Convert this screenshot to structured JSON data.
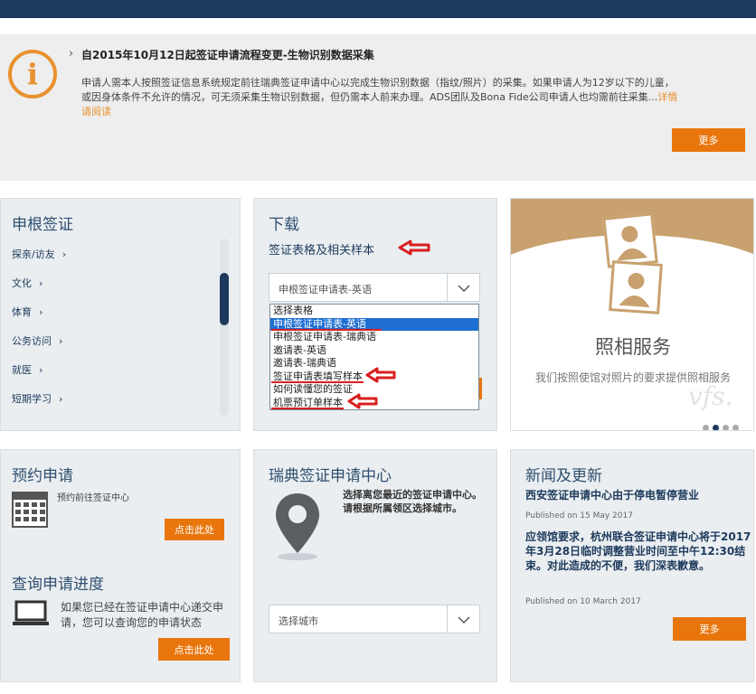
{
  "notice": {
    "chevron": "›",
    "icon": "i",
    "title": "自2015年10月12日起签证申请流程变更-生物识别数据采集",
    "body": "申请人需本人按照签证信息系统规定前往瑞典签证申请中心以完成生物识别数据（指纹/照片）的采集。如果申请人为12岁以下的儿童，或因身体条件不允许的情况，可无须采集生物识别数据，但仍需本人前来办理。ADS团队及Bona Fide公司申请人也均需前往采集...",
    "link": "详情请阅读",
    "more_label": "更多"
  },
  "schengen": {
    "title": "申根签证",
    "items": [
      "探亲/访友",
      "文化",
      "体育",
      "公务访问",
      "就医",
      "短期学习"
    ],
    "chevron": "›"
  },
  "download": {
    "title": "下载",
    "subtitle": "签证表格及相关样本",
    "select_value": "申根签证申请表-英语",
    "options": [
      "选择表格",
      "申根签证申请表-英语",
      "申根签证申请表-瑞典语",
      "邀请表-英语",
      "邀请表-瑞典语",
      "签证申请表填写样本",
      "如何读懂您的签证",
      "机票预订单样本"
    ],
    "selected_index": 1
  },
  "photo": {
    "title": "照相服务",
    "desc": "我们按照使馆对照片的要求提供照相服务",
    "watermark": "vfs."
  },
  "appointment": {
    "title": "预约申请",
    "text": "预约前往签证中心",
    "button": "点击此处"
  },
  "track": {
    "title": "查询申请进度",
    "text": "如果您已经在签证申请中心递交申请，您可以查询您的申请状态",
    "button": "点击此处"
  },
  "centre": {
    "title": "瑞典签证申请中心",
    "text": "选择离您最近的签证申请中心。请根据所属领区选择城市。",
    "select_value": "选择城市"
  },
  "news": {
    "title": "新闻及更新",
    "item1": "西安签证申请中心由于停电暂停营业",
    "date1": "Published on 15 May 2017",
    "item2": "应领馆要求，杭州联合签证申请中心将于2017年3月28日临时调整营业时间至中午12:30结束。对此造成的不便，我们深表歉意。",
    "date2": "Published on 10 March 2017",
    "more_label": "更多"
  },
  "colors": {
    "navy": "#1d3a5c",
    "orange": "#e8760d",
    "annotation_red": "#d91f1f",
    "photo_tan": "#c8a16f"
  }
}
